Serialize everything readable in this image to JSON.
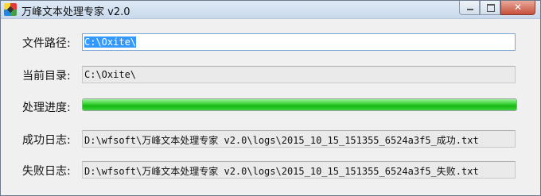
{
  "window": {
    "title": "万峰文本处理专家 v2.0",
    "close_glyph": "✕"
  },
  "fields": {
    "file_path": {
      "label": "文件路径:",
      "value": "C:\\Oxite\\"
    },
    "current_dir": {
      "label": "当前目录:",
      "value": "C:\\Oxite\\"
    },
    "progress": {
      "label": "处理进度:",
      "percent": 100,
      "color": "#17b814"
    },
    "success_log": {
      "label": "成功日志:",
      "value": "D:\\wfsoft\\万峰文本处理专家 v2.0\\logs\\2015_10_15_151355_6524a3f5_成功.txt"
    },
    "fail_log": {
      "label": "失败日志:",
      "value": "D:\\wfsoft\\万峰文本处理专家 v2.0\\logs\\2015_10_15_151355_6524a3f5_失败.txt"
    }
  }
}
